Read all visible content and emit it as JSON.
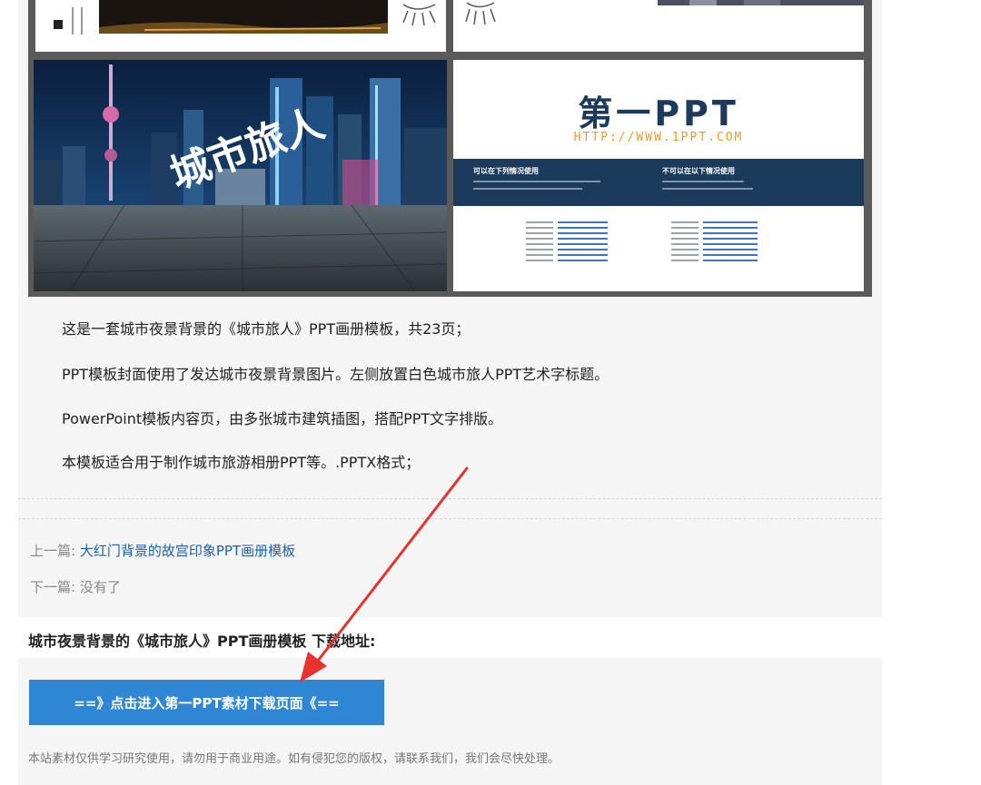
{
  "gallery": {
    "cover_title": "城市旅人",
    "brand": {
      "name": "第一PPT",
      "url": "HTTP://WWW.1PPT.COM",
      "banner_left_title": "可以在下列情况使用",
      "banner_right_title": "不可以在以下情况使用"
    }
  },
  "description": {
    "line1": "这是一套城市夜景背景的《城市旅人》PPT画册模板，共23页；",
    "line2": "PPT模板封面使用了发达城市夜景背景图片。左侧放置白色城市旅人PPT艺术字标题。",
    "line3": "PowerPoint模板内容页，由多张城市建筑插图，搭配PPT文字排版。",
    "line4": "本模板适合用于制作城市旅游相册PPT等。.PPTX格式；"
  },
  "nav": {
    "prev_label": "上一篇:",
    "prev_link": "大红门背景的故宫印象PPT画册模板",
    "next_label": "下一篇:",
    "next_text": "没有了"
  },
  "download": {
    "title": "城市夜景背景的《城市旅人》PPT画册模板 下载地址:",
    "button_label": "==》点击进入第一PPT素材下载页面《==",
    "disclaimer": "本站素材仅供学习研究使用，请勿用于商业用途。如有侵犯您的版权，请联系我们，我们会尽快处理。"
  },
  "colors": {
    "button": "#2e86d4",
    "link": "#1f5fa8",
    "arrow": "#e8322e",
    "brand_navy": "#1b3a5c",
    "brand_orange": "#f29a1d"
  }
}
